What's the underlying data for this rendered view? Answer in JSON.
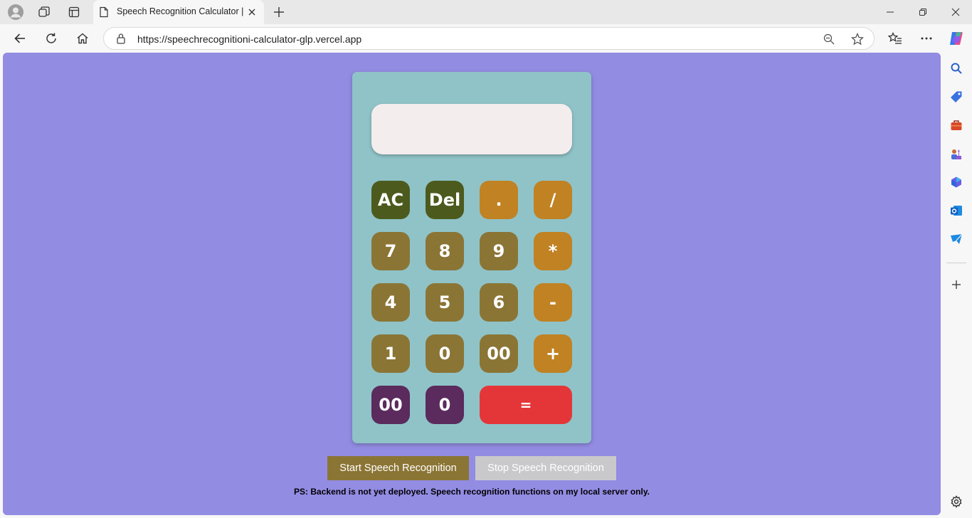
{
  "browser": {
    "tab_title": "Speech Recognition Calculator | GLP",
    "url": "https://speechrecognitioni-calculator-glp.vercel.app"
  },
  "calculator": {
    "display_value": "",
    "rows": [
      [
        {
          "label": "AC",
          "kind": "ctrl"
        },
        {
          "label": "Del",
          "kind": "ctrl"
        },
        {
          "label": ".",
          "kind": "op"
        },
        {
          "label": "/",
          "kind": "op"
        }
      ],
      [
        {
          "label": "7",
          "kind": "num"
        },
        {
          "label": "8",
          "kind": "num"
        },
        {
          "label": "9",
          "kind": "num"
        },
        {
          "label": "*",
          "kind": "op"
        }
      ],
      [
        {
          "label": "4",
          "kind": "num"
        },
        {
          "label": "5",
          "kind": "num"
        },
        {
          "label": "6",
          "kind": "num"
        },
        {
          "label": "-",
          "kind": "op"
        }
      ],
      [
        {
          "label": "1",
          "kind": "num"
        },
        {
          "label": "0",
          "kind": "num"
        },
        {
          "label": "00",
          "kind": "num"
        },
        {
          "label": "+",
          "kind": "op"
        }
      ],
      [
        {
          "label": "00",
          "kind": "alt"
        },
        {
          "label": "0",
          "kind": "alt"
        },
        {
          "label": "=",
          "kind": "eq"
        }
      ]
    ]
  },
  "speech": {
    "start_label": "Start Speech Recognition",
    "stop_label": "Stop Speech Recognition",
    "note": "PS: Backend is not yet deployed. Speech recognition functions on my local server only."
  },
  "colors": {
    "page_background": "#938ce3",
    "calculator_body": "#8fc3c8",
    "key_control": "#4d5a1e",
    "key_number": "#8b7535",
    "key_operator": "#c08223",
    "key_alternate": "#5a2b5c",
    "key_equals": "#e43638",
    "start_button": "#8b7535",
    "stop_button": "#c9c9cc"
  },
  "icons": {
    "tab_strip": [
      "profile-icon",
      "workspaces-icon",
      "tab-actions-icon",
      "page-icon",
      "close-icon",
      "new-tab-icon"
    ],
    "window_controls": [
      "minimize-icon",
      "restore-icon",
      "close-window-icon"
    ],
    "toolbar": [
      "back-icon",
      "refresh-icon",
      "home-icon",
      "lock-icon",
      "zoom-out-icon",
      "favorite-star-icon",
      "favorites-icon",
      "more-icon",
      "copilot-icon"
    ],
    "side_panel": [
      "search-icon",
      "shopping-tag-icon",
      "tools-icon",
      "games-icon",
      "microsoft365-icon",
      "outlook-icon",
      "drop-icon",
      "add-icon",
      "settings-icon"
    ]
  }
}
